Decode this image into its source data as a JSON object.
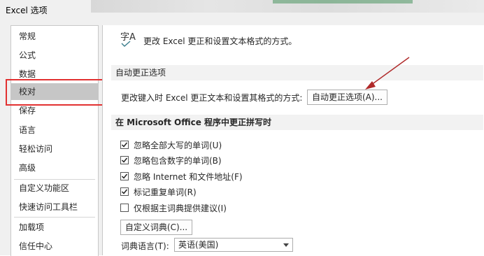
{
  "window": {
    "title": "Excel 选项"
  },
  "sidebar": {
    "items": [
      {
        "label": "常规"
      },
      {
        "label": "公式"
      },
      {
        "label": "数据"
      },
      {
        "label": "校对",
        "selected": true
      },
      {
        "label": "保存"
      },
      {
        "label": "语言"
      },
      {
        "label": "轻松访问"
      },
      {
        "label": "高级"
      },
      {
        "label": "自定义功能区"
      },
      {
        "label": "快速访问工具栏"
      },
      {
        "label": "加载项"
      },
      {
        "label": "信任中心"
      }
    ]
  },
  "header": {
    "icon_text": "字A",
    "description": "更改 Excel 更正和设置文本格式的方式。"
  },
  "autocorrect": {
    "section_title": "自动更正选项",
    "row_label": "更改键入时 Excel 更正文本和设置其格式的方式:",
    "button_label": "自动更正选项(A)..."
  },
  "spelling": {
    "section_title": "在 Microsoft Office 程序中更正拼写时",
    "options": [
      {
        "label": "忽略全部大写的单词(U)",
        "checked": true
      },
      {
        "label": "忽略包含数字的单词(B)",
        "checked": true
      },
      {
        "label": "忽略 Internet 和文件地址(F)",
        "checked": true
      },
      {
        "label": "标记重复单词(R)",
        "checked": true
      },
      {
        "label": "仅根据主词典提供建议(I)",
        "checked": false
      }
    ],
    "custom_dict_button": "自定义词典(C)...",
    "dict_lang_label": "词典语言(T):",
    "dict_lang_value": "英语(美国)"
  },
  "colors": {
    "highlight": "#e23131",
    "arrow": "#b02a2a",
    "selected_bg": "#c6c6c6"
  }
}
